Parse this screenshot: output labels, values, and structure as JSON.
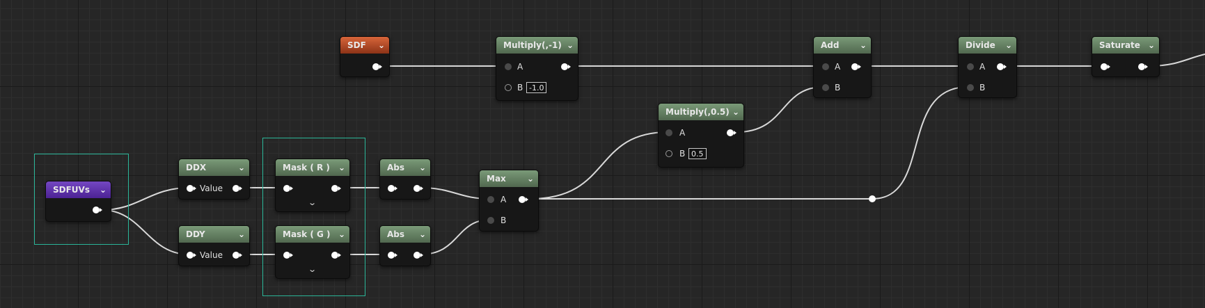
{
  "nodes": {
    "sdf": {
      "title": "SDF"
    },
    "multneg": {
      "title": "Multiply(,-1)",
      "pin_a": "A",
      "pin_b": "B",
      "b_value": "-1.0"
    },
    "add": {
      "title": "Add",
      "pin_a": "A",
      "pin_b": "B"
    },
    "divide": {
      "title": "Divide",
      "pin_a": "A",
      "pin_b": "B"
    },
    "saturate": {
      "title": "Saturate"
    },
    "multhalf": {
      "title": "Multiply(,0.5)",
      "pin_a": "A",
      "pin_b": "B",
      "b_value": "0.5"
    },
    "sdfuvs": {
      "title": "SDFUVs"
    },
    "ddx": {
      "title": "DDX",
      "pin_in": "Value"
    },
    "ddy": {
      "title": "DDY",
      "pin_in": "Value"
    },
    "maskr": {
      "title": "Mask ( R )"
    },
    "maskg": {
      "title": "Mask ( G )"
    },
    "absr": {
      "title": "Abs"
    },
    "absg": {
      "title": "Abs"
    },
    "max": {
      "title": "Max",
      "pin_a": "A",
      "pin_b": "B"
    }
  },
  "icons": {
    "dropdown": "chevron-down-icon",
    "expand": "expand-arrow-icon"
  },
  "colors": {
    "material_header": "#6b8a69",
    "texture_param_header": "#b14a25",
    "function_header": "#5b2fa8",
    "comment_border": "#2bb79a",
    "wire": "#d9d9d9"
  }
}
